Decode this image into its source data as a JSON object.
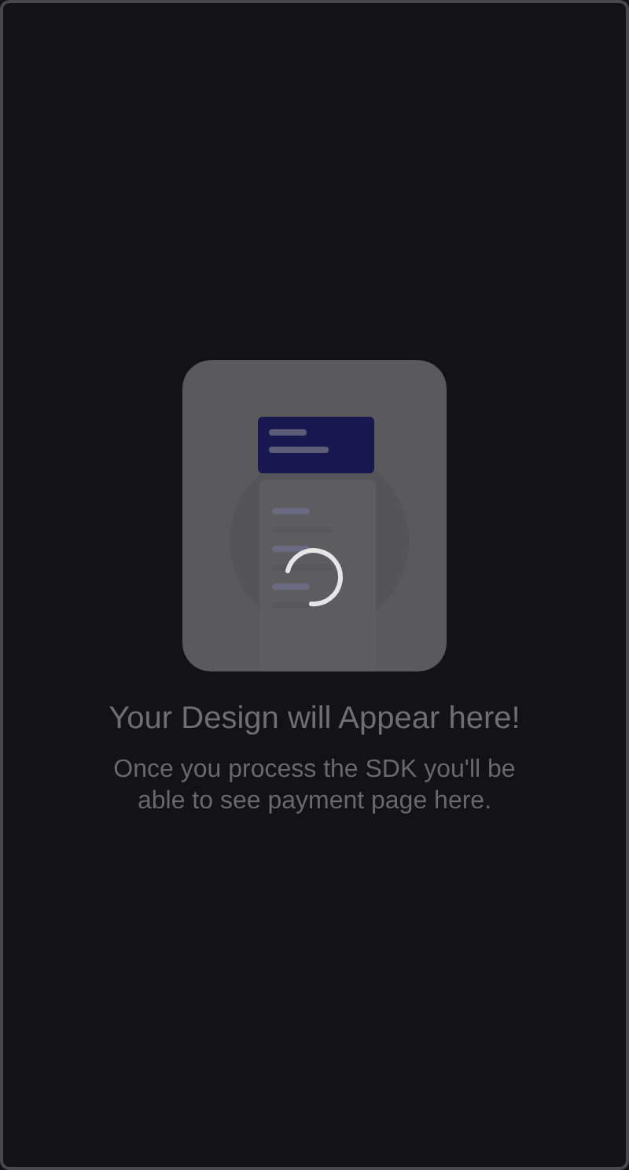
{
  "empty_state": {
    "title": "Your Design will Appear here!",
    "message": "Once you process the SDK you'll be able to see payment page here.",
    "loading": true
  }
}
